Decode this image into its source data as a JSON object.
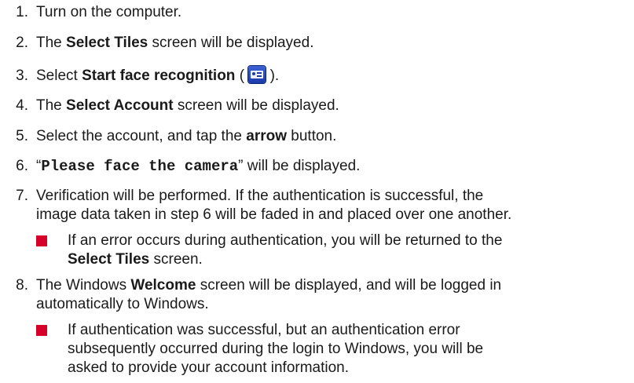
{
  "steps": [
    {
      "num": "1.",
      "text": "Turn on the computer."
    },
    {
      "num": "2.",
      "pre": "The ",
      "bold": "Select Tiles",
      "post": " screen will be displayed."
    },
    {
      "num": "3.",
      "pre": "Select ",
      "bold": "Start face recognition",
      "mid": " (",
      "post": ").",
      "icon": "face-recognition-icon"
    },
    {
      "num": "4.",
      "pre": "The ",
      "bold": "Select Account",
      "post": " screen will be displayed."
    },
    {
      "num": "5.",
      "pre": "Select the account, and tap the ",
      "bold": "arrow",
      "post": " button."
    },
    {
      "num": "6.",
      "quote_open": "“",
      "mono": "Please face the camera",
      "post": "” will be displayed."
    },
    {
      "num": "7.",
      "line1": "Verification will be performed. If the authentication is successful, the",
      "line2": "image data taken in step 6 will be faded in and placed over one another.",
      "sub": {
        "line1": "If an error occurs during authentication, you will be returned to the",
        "bold": "Select Tiles",
        "post": " screen."
      }
    },
    {
      "num": "8.",
      "pre": "The Windows ",
      "bold": "Welcome",
      "post": " screen will be displayed, and will be logged in",
      "line2": "automatically to Windows.",
      "sub": {
        "line1": "If authentication was successful, but an authentication error",
        "line2": "subsequently occurred during the login to Windows, you will be",
        "line3": "asked to provide your account information."
      }
    }
  ],
  "colors": {
    "bullet": "#d5002a",
    "icon": "#1c3aa8"
  }
}
